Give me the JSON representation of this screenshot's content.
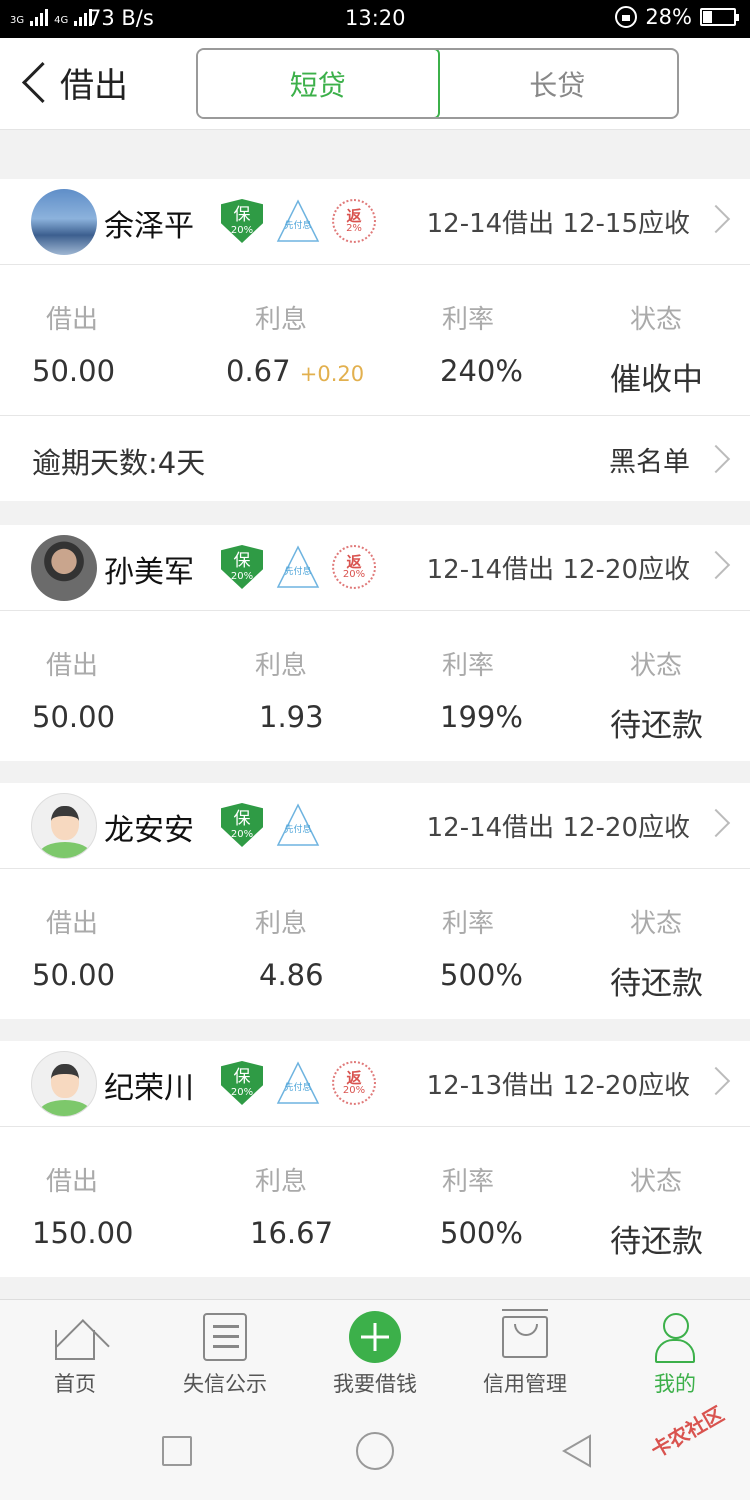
{
  "status_bar": {
    "network_left": "3G",
    "network_mid": "4G",
    "speed": "73 B/s",
    "time": "13:20",
    "battery": "28%"
  },
  "header": {
    "title": "借出",
    "tabs": [
      {
        "label": "短贷",
        "active": true
      },
      {
        "label": "长贷",
        "active": false
      }
    ]
  },
  "stat_labels": {
    "lent": "借出",
    "interest": "利息",
    "rate": "利率",
    "status": "状态"
  },
  "loans": [
    {
      "name": "余泽平",
      "badges": {
        "bao": "保",
        "bao_pct": "20%",
        "xian": "先付息",
        "fan": "返",
        "fan_pct": "2%"
      },
      "dates": "12-14借出 12-15应收",
      "lent": "50.00",
      "interest": "0.67",
      "interest_extra": "+0.20",
      "rate": "240%",
      "status": "催收中",
      "overdue": "逾期天数:4天",
      "blacklist": "黑名单"
    },
    {
      "name": "孙美军",
      "badges": {
        "bao": "保",
        "bao_pct": "20%",
        "xian": "先付息",
        "fan": "返",
        "fan_pct": "20%"
      },
      "dates": "12-14借出 12-20应收",
      "lent": "50.00",
      "interest": "1.93",
      "rate": "199%",
      "status": "待还款"
    },
    {
      "name": "龙安安",
      "badges": {
        "bao": "保",
        "bao_pct": "20%",
        "xian": "先付息"
      },
      "dates": "12-14借出 12-20应收",
      "lent": "50.00",
      "interest": "4.86",
      "rate": "500%",
      "status": "待还款"
    },
    {
      "name": "纪荣川",
      "badges": {
        "bao": "保",
        "bao_pct": "20%",
        "xian": "先付息",
        "fan": "返",
        "fan_pct": "20%"
      },
      "dates": "12-13借出 12-20应收",
      "lent": "150.00",
      "interest": "16.67",
      "rate": "500%",
      "status": "待还款"
    }
  ],
  "tabbar": [
    {
      "label": "首页",
      "icon": "home-icon"
    },
    {
      "label": "失信公示",
      "icon": "list-icon"
    },
    {
      "label": "我要借钱",
      "icon": "plus-icon"
    },
    {
      "label": "信用管理",
      "icon": "box-icon"
    },
    {
      "label": "我的",
      "icon": "user-icon",
      "active": true
    }
  ],
  "watermark": "卡农社区",
  "colors": {
    "accent": "#3cb04a",
    "interest_extra": "#e2b04e"
  }
}
